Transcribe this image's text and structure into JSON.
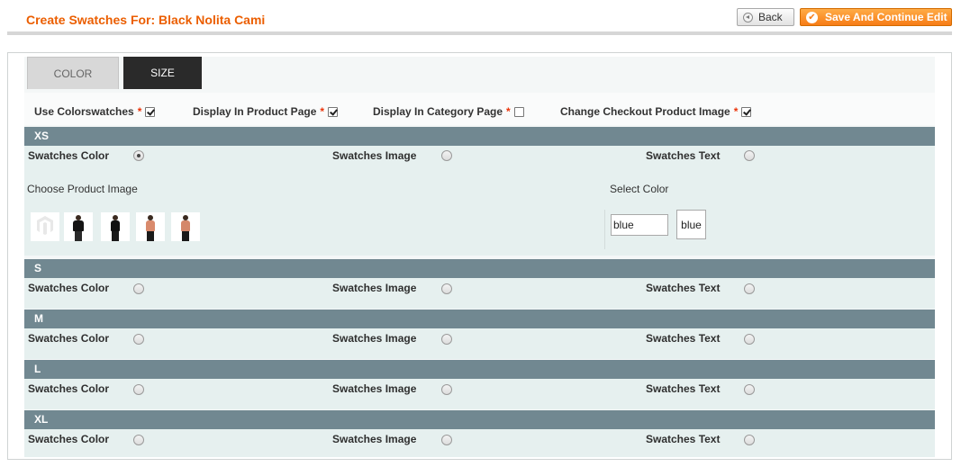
{
  "header": {
    "title": "Create Swatches For: Black Nolita Cami",
    "back_label": "Back",
    "save_label": "Save And Continue Edit",
    "accent_color": "#eb5e00"
  },
  "tabs": [
    {
      "label": "COLOR",
      "active": false
    },
    {
      "label": "SIZE",
      "active": true
    }
  ],
  "options": [
    {
      "label": "Use Colorswatches",
      "required": "*",
      "checked": true
    },
    {
      "label": "Display In Product Page",
      "required": "*",
      "checked": true
    },
    {
      "label": "Display In Category Page",
      "required": "*",
      "checked": false
    },
    {
      "label": "Change Checkout Product Image",
      "required": "*",
      "checked": true
    }
  ],
  "swatch_types": {
    "color": "Swatches Color",
    "image": "Swatches Image",
    "text": "Swatches Text"
  },
  "sizes": [
    {
      "name": "XS",
      "selected": "color",
      "expanded": true
    },
    {
      "name": "S",
      "selected": null
    },
    {
      "name": "M",
      "selected": null
    },
    {
      "name": "L",
      "selected": null
    },
    {
      "name": "XL",
      "selected": null
    }
  ],
  "xs_detail": {
    "choose_image_label": "Choose Product Image",
    "select_color_label": "Select Color",
    "color_value": "blue",
    "color_preview": "blue",
    "thumbnails": [
      "magento-logo-icon",
      "black-cami-front",
      "black-cami-side",
      "coral-top-front",
      "coral-top-back"
    ]
  },
  "colors": {
    "size_header_bg": "#718891",
    "row_bg": "#e6f0ef",
    "save_button": "#f77c16"
  }
}
